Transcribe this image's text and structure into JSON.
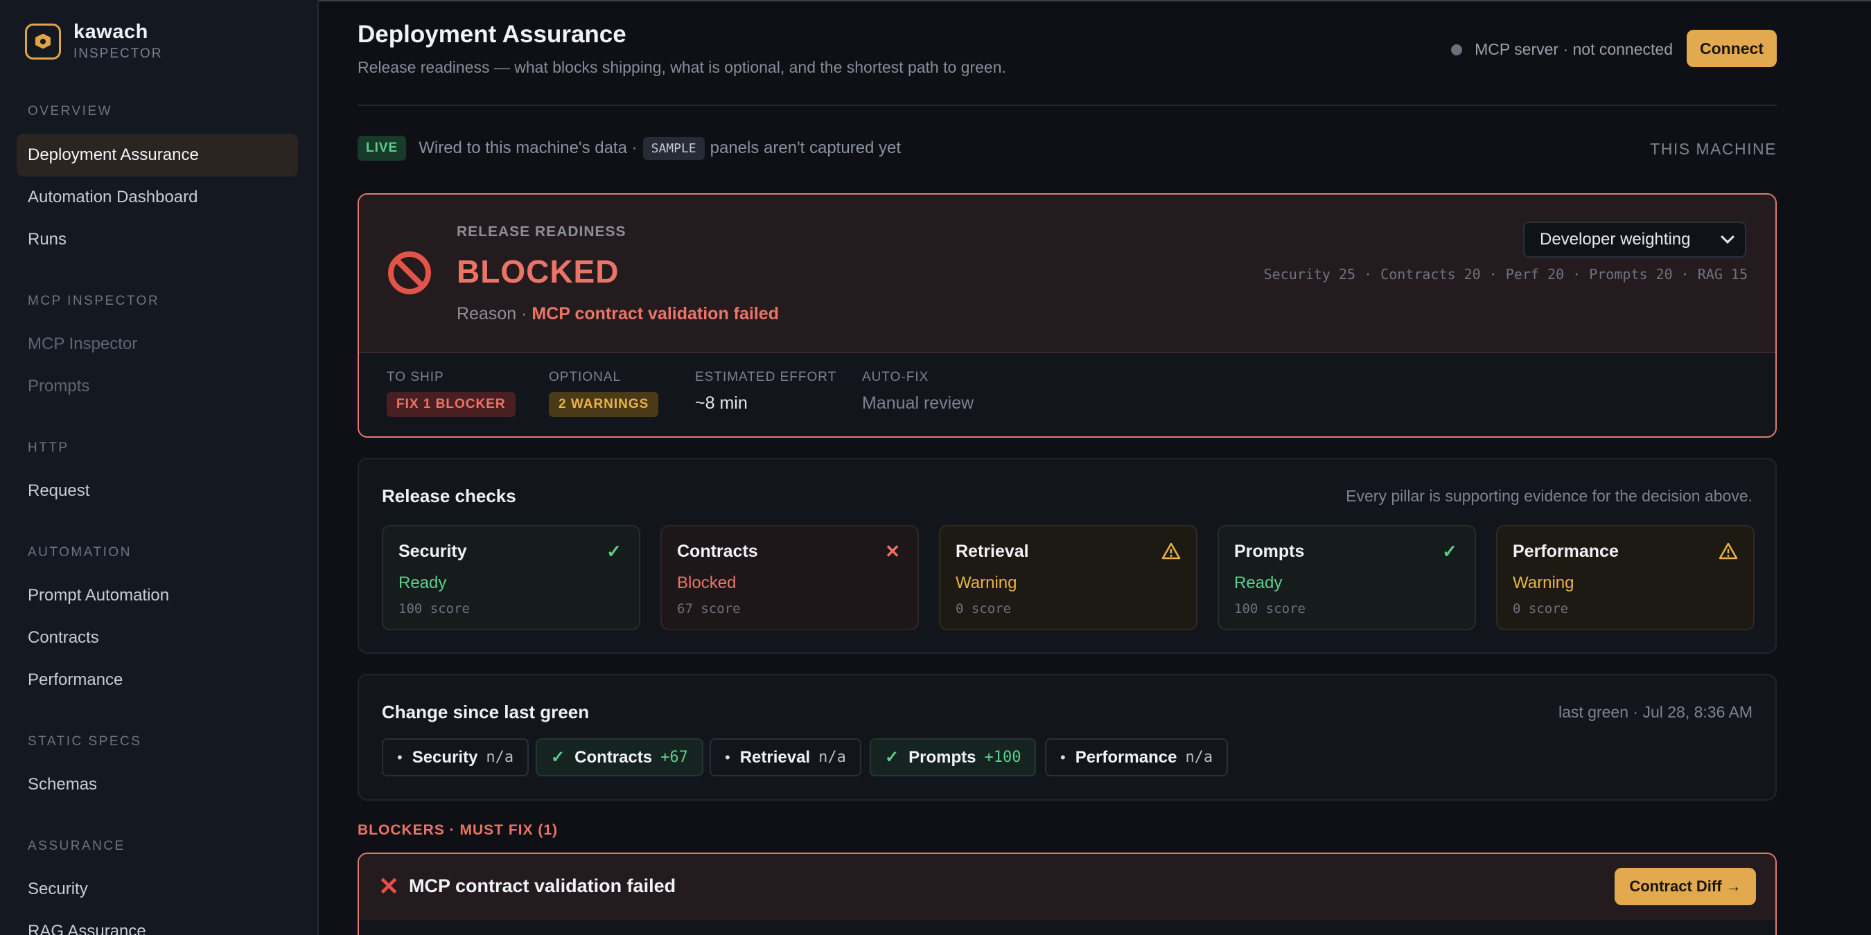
{
  "brand": {
    "name": "kawach",
    "subtitle": "INSPECTOR"
  },
  "sidebar": {
    "sections": [
      {
        "title": "OVERVIEW",
        "items": [
          {
            "label": "Deployment Assurance",
            "active": true
          },
          {
            "label": "Automation Dashboard"
          },
          {
            "label": "Runs"
          }
        ]
      },
      {
        "title": "MCP INSPECTOR",
        "items": [
          {
            "label": "MCP Inspector",
            "muted": true
          },
          {
            "label": "Prompts",
            "muted": true
          }
        ]
      },
      {
        "title": "HTTP",
        "items": [
          {
            "label": "Request"
          }
        ]
      },
      {
        "title": "AUTOMATION",
        "items": [
          {
            "label": "Prompt Automation"
          },
          {
            "label": "Contracts"
          },
          {
            "label": "Performance"
          }
        ]
      },
      {
        "title": "STATIC SPECS",
        "items": [
          {
            "label": "Schemas"
          }
        ]
      },
      {
        "title": "ASSURANCE",
        "items": [
          {
            "label": "Security"
          },
          {
            "label": "RAG Assurance"
          }
        ]
      }
    ]
  },
  "header": {
    "title": "Deployment Assurance",
    "subtitle": "Release readiness — what blocks shipping, what is optional, and the shortest path to green.",
    "mcp_status": "MCP server · not connected",
    "connect_label": "Connect"
  },
  "live_bar": {
    "live_badge": "LIVE",
    "text_before": "Wired to this machine's data ·",
    "sample_badge": "SAMPLE",
    "text_after": "panels aren't captured yet",
    "scope": "THIS MACHINE"
  },
  "readiness": {
    "label": "RELEASE READINESS",
    "status": "BLOCKED",
    "reason_prefix": "Reason ·",
    "reason": "MCP contract validation failed",
    "weighting": "Developer weighting",
    "weights": "Security 25 · Contracts 20 · Perf 20 · Prompts 20 · RAG 15",
    "to_ship_label": "TO SHIP",
    "to_ship_value": "FIX 1 BLOCKER",
    "optional_label": "OPTIONAL",
    "optional_value": "2 WARNINGS",
    "effort_label": "ESTIMATED EFFORT",
    "effort_value": "~8 min",
    "autofix_label": "AUTO-FIX",
    "autofix_value": "Manual review"
  },
  "release_checks": {
    "title": "Release checks",
    "note": "Every pillar is supporting evidence for the decision above.",
    "cards": [
      {
        "name": "Security",
        "status": "Ready",
        "score": "100 score",
        "icon": "check-icon"
      },
      {
        "name": "Contracts",
        "status": "Blocked",
        "score": "67 score",
        "icon": "x-icon"
      },
      {
        "name": "Retrieval",
        "status": "Warning",
        "score": "0 score",
        "icon": "warning-icon"
      },
      {
        "name": "Prompts",
        "status": "Ready",
        "score": "100 score",
        "icon": "check-icon"
      },
      {
        "name": "Performance",
        "status": "Warning",
        "score": "0 score",
        "icon": "warning-icon"
      }
    ]
  },
  "change_since": {
    "title": "Change since last green",
    "last_green": "last green · Jul 28, 8:36 AM",
    "chips": [
      {
        "name": "Security",
        "delta": "n/a"
      },
      {
        "name": "Contracts",
        "delta": "+67"
      },
      {
        "name": "Retrieval",
        "delta": "n/a"
      },
      {
        "name": "Prompts",
        "delta": "+100"
      },
      {
        "name": "Performance",
        "delta": "n/a"
      }
    ]
  },
  "blockers": {
    "heading": "BLOCKERS · MUST FIX (1)",
    "items": [
      {
        "title": "MCP contract validation failed",
        "action": "Contract Diff →"
      }
    ]
  },
  "colors": {
    "accent": "#e2a94e",
    "danger": "#ec7467",
    "success": "#5bd08b",
    "warning": "#e8b347",
    "background": "#0e1015"
  }
}
